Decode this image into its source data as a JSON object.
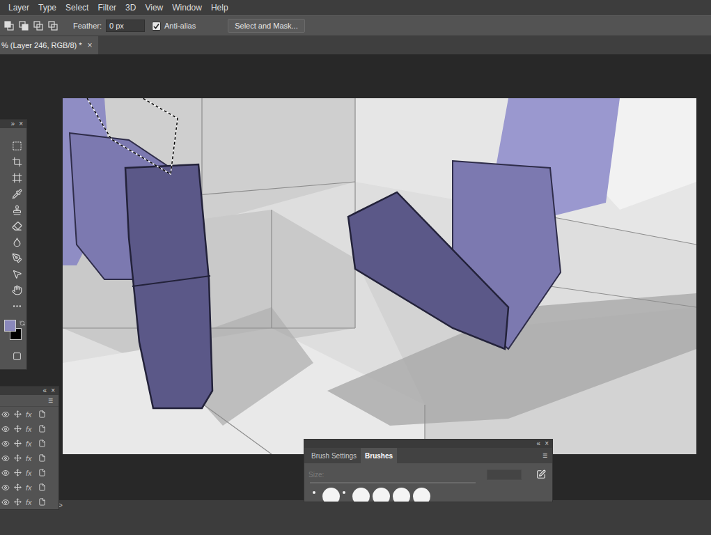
{
  "menu": [
    {
      "label": "Layer"
    },
    {
      "label": "Type"
    },
    {
      "label": "Select"
    },
    {
      "label": "Filter"
    },
    {
      "label": "3D"
    },
    {
      "label": "View"
    },
    {
      "label": "Window"
    },
    {
      "label": "Help"
    }
  ],
  "options": {
    "feather_label": "Feather:",
    "feather_value": "0 px",
    "anti_alias": {
      "label": "Anti-alias",
      "checked": true
    },
    "button": "Select and Mask..."
  },
  "document_tab": {
    "title": "% (Layer 246, RGB/8) *",
    "close": "×",
    "selected": true
  },
  "tools_panel": {
    "collapse": "»",
    "close": "×",
    "foreground_color": "#8a88bb",
    "background_color": "#000000"
  },
  "layers_panel": {
    "collapse": "«",
    "close": "×",
    "menu": "≡",
    "rows": [
      {
        "visible": true,
        "fx": "fx"
      },
      {
        "visible": true,
        "fx": "fx"
      },
      {
        "visible": true,
        "fx": "fx"
      },
      {
        "visible": true,
        "fx": "fx"
      },
      {
        "visible": true,
        "fx": "fx"
      },
      {
        "visible": true,
        "fx": "fx"
      },
      {
        "visible": true,
        "fx": "fx"
      }
    ]
  },
  "brush_panel": {
    "collapse": "«",
    "close": "×",
    "menu": "≡",
    "tabs": [
      {
        "label": "Brush Settings",
        "selected": false
      },
      {
        "label": "Brushes",
        "selected": true
      }
    ],
    "size_label": "Size:",
    "size_disabled": true,
    "presets": [
      {
        "kind": "dot"
      },
      {
        "kind": "round"
      },
      {
        "kind": "dot"
      },
      {
        "kind": "round"
      },
      {
        "kind": "round"
      },
      {
        "kind": "round"
      },
      {
        "kind": "round"
      }
    ]
  },
  "bottom_bar": {
    "expand": ">"
  }
}
